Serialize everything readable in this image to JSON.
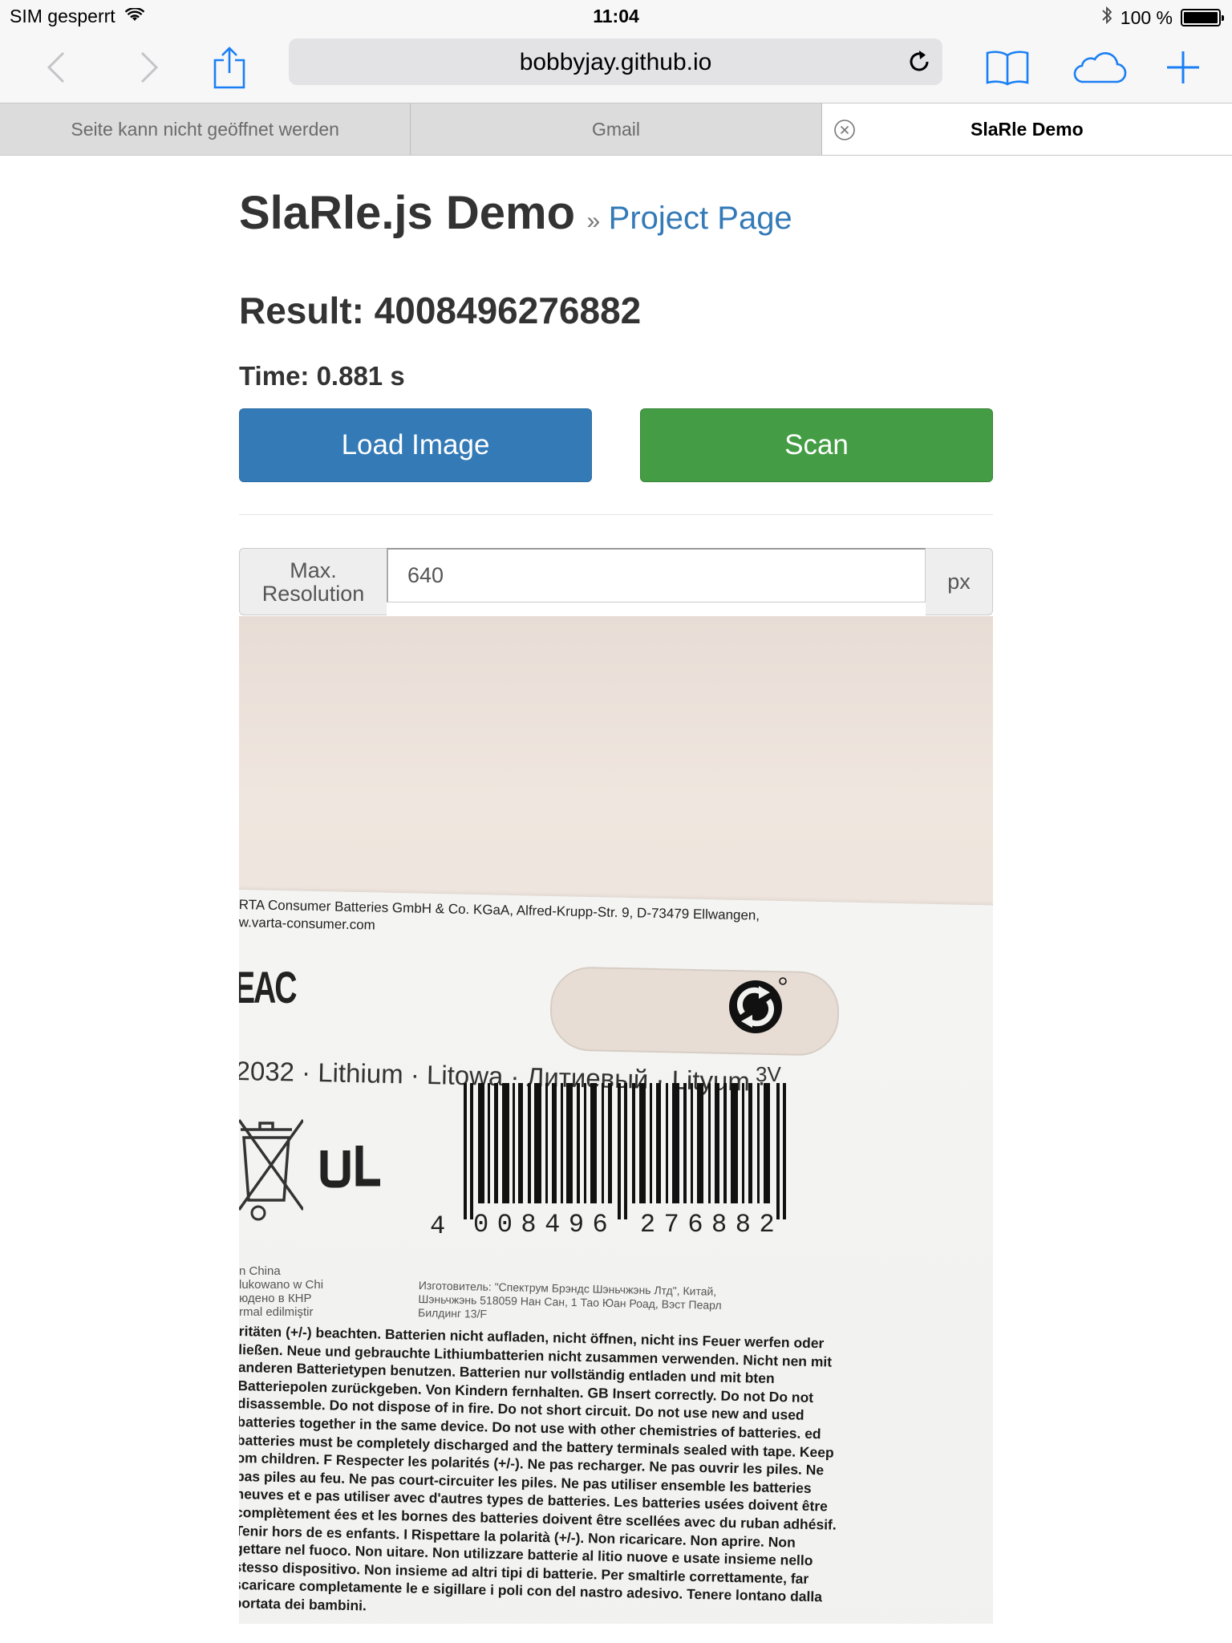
{
  "status_bar": {
    "carrier": "SIM gesperrt",
    "time": "11:04",
    "battery_text": "100 %",
    "icons": [
      "wifi-icon",
      "bluetooth-icon",
      "battery-icon"
    ]
  },
  "toolbar": {
    "url": "bobbyjay.github.io",
    "icons": [
      "back-icon",
      "forward-icon",
      "share-icon",
      "reload-icon",
      "bookmarks-icon",
      "icloud-tabs-icon",
      "new-tab-icon"
    ]
  },
  "tabs": [
    {
      "label": "Seite kann nicht geöffnet werden"
    },
    {
      "label": "Gmail"
    },
    {
      "label": "SlaRle Demo"
    }
  ],
  "page": {
    "title": "SlaRle.js Demo",
    "separator": "»",
    "project_link": "Project Page",
    "result_label": "Result: 4008496276882",
    "time_label": "Time: 0.881 s",
    "load_button": "Load Image",
    "scan_button": "Scan",
    "max_res_line1": "Max.",
    "max_res_line2": "Resolution",
    "max_res_value": "640",
    "max_res_unit": "px"
  },
  "photo": {
    "company_line1": "RTA Consumer Batteries GmbH & Co. KGaA, Alfred-Krupp-Str. 9, D-73479 Ellwangen,",
    "company_line2": "w.varta-consumer.com",
    "eac_mark": "EAC",
    "product_line": "2032 · Lithium · Litowa · Литиевый · Lityum ·",
    "voltage": "3V",
    "barcode_first": "4",
    "barcode_digits": "008496 276882",
    "made_in_lines": [
      "n China",
      "lukowano w Chi",
      "юдено в КНР",
      "rmal edilmiştir"
    ],
    "manufacturer_lines": [
      "Изготовитель: \"Спектрум Брэндс Шэньчжэнь Лтд\", Китай,",
      "Шэньчжэнь 518059 Нан Сан, 1 Тао Юан Роад, Вэст Пеарл",
      "Билдинг 13/F"
    ],
    "fine_print": "ritäten (+/-) beachten. Batterien nicht aufladen, nicht öffnen, nicht ins Feuer werfen oder ließen. Neue und gebrauchte Lithiumbatterien nicht zusammen verwenden. Nicht nen mit anderen Batterietypen benutzen. Batterien nur vollständig entladen und mit bten Batteriepolen zurückgeben. Von Kindern fernhalten. GB Insert correctly. Do not Do not disassemble. Do not dispose of in fire. Do not short circuit. Do not use new and used batteries together in the same device. Do not use with other chemistries of batteries. ed batteries must be completely discharged and the battery terminals sealed with tape. Keep om children. F Respecter les polarités (+/-). Ne pas recharger. Ne pas ouvrir les piles. Ne pas piles au feu. Ne pas court-circuiter les piles. Ne pas utiliser ensemble les batteries neuves et e pas utiliser avec d'autres types de batteries. Les batteries usées doivent être complètement ées et les bornes des batteries doivent être scellées avec du ruban adhésif. Tenir hors de es enfants. I Rispettare la polarità (+/-). Non ricaricare. Non aprire. Non gettare nel fuoco. Non uitare. Non utilizzare batterie al litio nuove e usate insieme nello stesso dispositivo. Non insieme ad altri tipi di batterie. Per smaltirle correttamente, far scaricare completamente le e sigillare i poli con del nastro adesivo. Tenere lontano dalla portata dei bambini."
  }
}
